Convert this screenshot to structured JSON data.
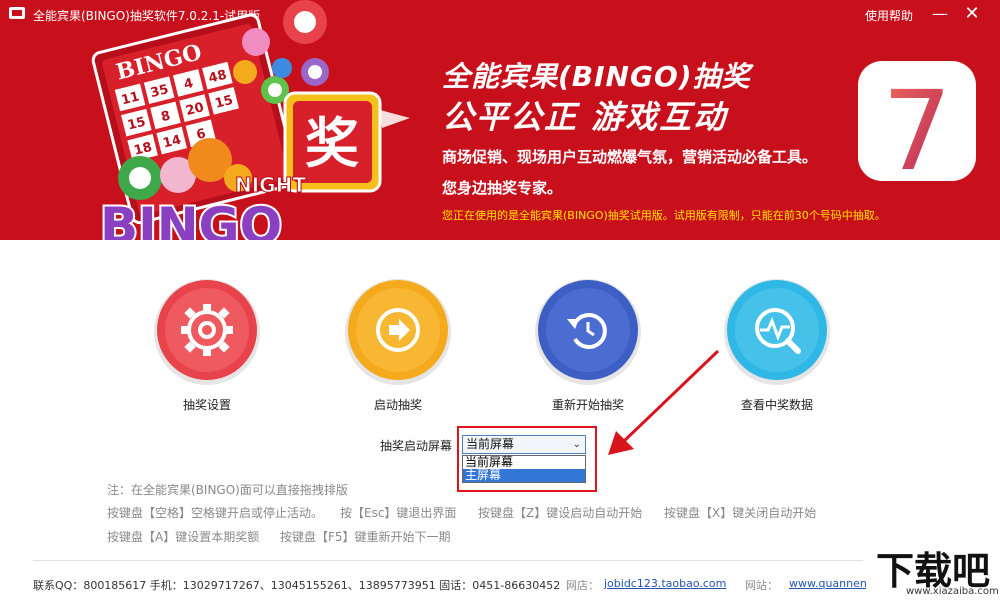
{
  "window": {
    "title": "全能宾果(BINGO)抽奖软件7.0.2.1-试用版",
    "help_label": "使用帮助",
    "minimize_label": "—",
    "close_label": "✕"
  },
  "banner": {
    "hero_title": "全能宾果(BINGO)抽奖",
    "hero_subtitle": "公平公正  游戏互动",
    "line1": "商场促销、现场用户互动燃爆气氛，营销活动必备工具。",
    "line2": "您身边抽奖专家。",
    "trial_notice": "您正在使用的是全能宾果(BINGO)抽奖试用版。试用版有限制，只能在前30个号码中抽取。",
    "art_text_bingo": "BINGO",
    "art_text_night": "NIGHT",
    "art_text_prize": "奖",
    "card_numbers": [
      "11",
      "35",
      "4",
      "48",
      "15",
      "8",
      "20",
      "15",
      "18",
      "14",
      "6"
    ],
    "version": "7",
    "colors": {
      "banner": "#c8101c",
      "notice": "#ffe400"
    }
  },
  "features": [
    {
      "label": "抽奖设置",
      "icon": "gear-icon",
      "color": "#e8434b"
    },
    {
      "label": "启动抽奖",
      "icon": "play-arrow-icon",
      "color": "#f5a91c"
    },
    {
      "label": "重新开始抽奖",
      "icon": "restart-icon",
      "color": "#3d5fc4"
    },
    {
      "label": "查看中奖数据",
      "icon": "chart-search-icon",
      "color": "#2fb7e5"
    }
  ],
  "screen_select": {
    "label": "抽奖启动屏幕",
    "current_value": "当前屏幕",
    "options": [
      "当前屏幕",
      "主屏幕"
    ],
    "highlighted_option": "主屏幕"
  },
  "notes": {
    "drag_note": "注：在全能宾果(BINGO)面可以直接拖拽排版",
    "shortcuts": [
      "按键盘【空格】空格键开启或停止活动。",
      "按【Esc】键退出界面",
      "按键盘【Z】键设启动自动开始",
      "按键盘【X】键关闭自动开始",
      "按键盘【A】键设置本期奖额",
      "按键盘【F5】键重新开始下一期"
    ]
  },
  "footer": {
    "contact": "联系QQ：800185617  手机：13029717267、13045155261、13895773951  固话：0451-86630452",
    "shop_label": "网店：",
    "shop_link": "jobidc123.taobao.com",
    "site_label": "网站：",
    "site_link": "www.quannengy"
  },
  "watermark": {
    "text": "下载吧",
    "url": "www.xiazaiba.com"
  }
}
